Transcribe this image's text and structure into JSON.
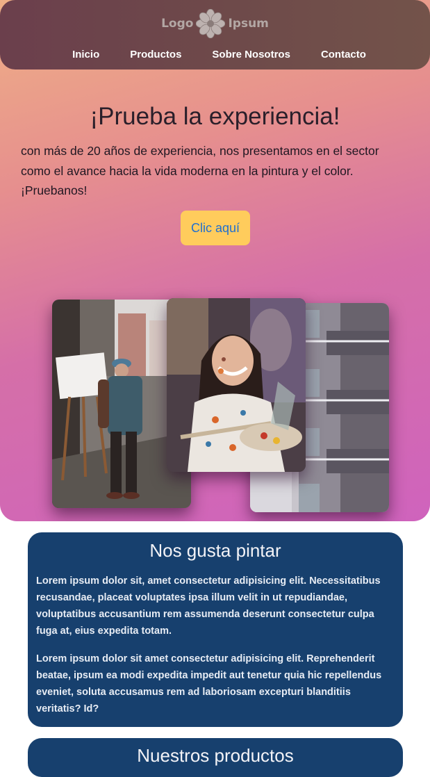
{
  "header": {
    "logo_left": "Logo",
    "logo_right": "Ipsum",
    "nav": [
      {
        "label": "Inicio"
      },
      {
        "label": "Productos"
      },
      {
        "label": "Sobre Nosotros"
      },
      {
        "label": "Contacto"
      }
    ]
  },
  "hero": {
    "title": "¡Prueba la experiencia!",
    "text": "con más de 20 años de experiencia, nos presentamos en el sector como el avance hacia la vida moderna en la pintura y el color. ¡Pruebanos!",
    "cta_label": "Clic aquí"
  },
  "sections": {
    "about_title": "Nos gusta pintar",
    "about_p1": "Lorem ipsum dolor sit, amet consectetur adipisicing elit. Necessitatibus recusandae, placeat voluptates ipsa illum velit in ut repudiandae, voluptatibus accusantium rem assumenda deserunt consectetur culpa fuga at, eius expedita totam.",
    "about_p2": "Lorem ipsum dolor sit amet consectetur adipisicing elit. Reprehenderit beatae, ipsum ea modi expedita impedit aut tenetur quia hic repellendus eveniet, soluta accusamus rem ad laboriosam excepturi blanditiis veritatis? Id?",
    "products_title": "Nuestros productos"
  },
  "colors": {
    "card_bg": "#17406e",
    "cta_bg": "#ffcc5c",
    "cta_text": "#1f6fd1"
  }
}
